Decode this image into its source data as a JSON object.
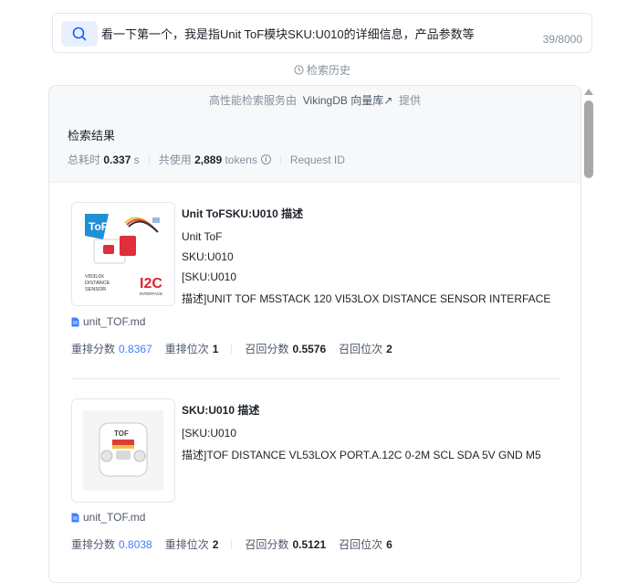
{
  "search": {
    "query": "看一下第一个，我是指Unit ToF模块SKU:U010的详细信息，产品参数等",
    "char_count": "39/8000"
  },
  "history_label": "检索历史",
  "powered": {
    "prefix": "高性能检索服务由",
    "brand": "VikingDB 向量库",
    "suffix": "提供"
  },
  "results_header": {
    "title": "检索结果",
    "time_label": "总耗时",
    "time_value": "0.337",
    "time_unit": "s",
    "tokens_label": "共使用",
    "tokens_value": "2,889",
    "tokens_unit": "tokens",
    "request_id_label": "Request ID"
  },
  "results": [
    {
      "title": "Unit ToFSKU:U010 描述",
      "lines": [
        "Unit ToF",
        "SKU:U010",
        "[SKU:U010",
        "描述]UNIT TOF M5STACK 120 VI53LOX DISTANCE SENSOR INTERFACE"
      ],
      "file": "unit_TOF.md",
      "rerank_score_label": "重排分数",
      "rerank_score": "0.8367",
      "rerank_rank_label": "重排位次",
      "rerank_rank": "1",
      "recall_score_label": "召回分数",
      "recall_score": "0.5576",
      "recall_rank_label": "召回位次",
      "recall_rank": "2",
      "image_text": {
        "badge": "ToF",
        "sensor": "VI53L0X",
        "line2": "DISTANCE",
        "line3": "SENSOR",
        "i2c": "I2C",
        "interface": "INTERFACE"
      }
    },
    {
      "title": "SKU:U010 描述",
      "lines": [
        "[SKU:U010",
        "描述]TOF DISTANCE VL53LOX PORT.A.12C 0-2M SCL SDA 5V GND M5"
      ],
      "file": "unit_TOF.md",
      "rerank_score_label": "重排分数",
      "rerank_score": "0.8038",
      "rerank_rank_label": "重排位次",
      "rerank_rank": "2",
      "recall_score_label": "召回分数",
      "recall_score": "0.5121",
      "recall_rank_label": "召回位次",
      "recall_rank": "6",
      "image_text": {
        "badge": "TOF"
      }
    }
  ],
  "colors": {
    "accent": "#4080ff",
    "muted": "#86909c",
    "border": "#e5e6eb"
  }
}
